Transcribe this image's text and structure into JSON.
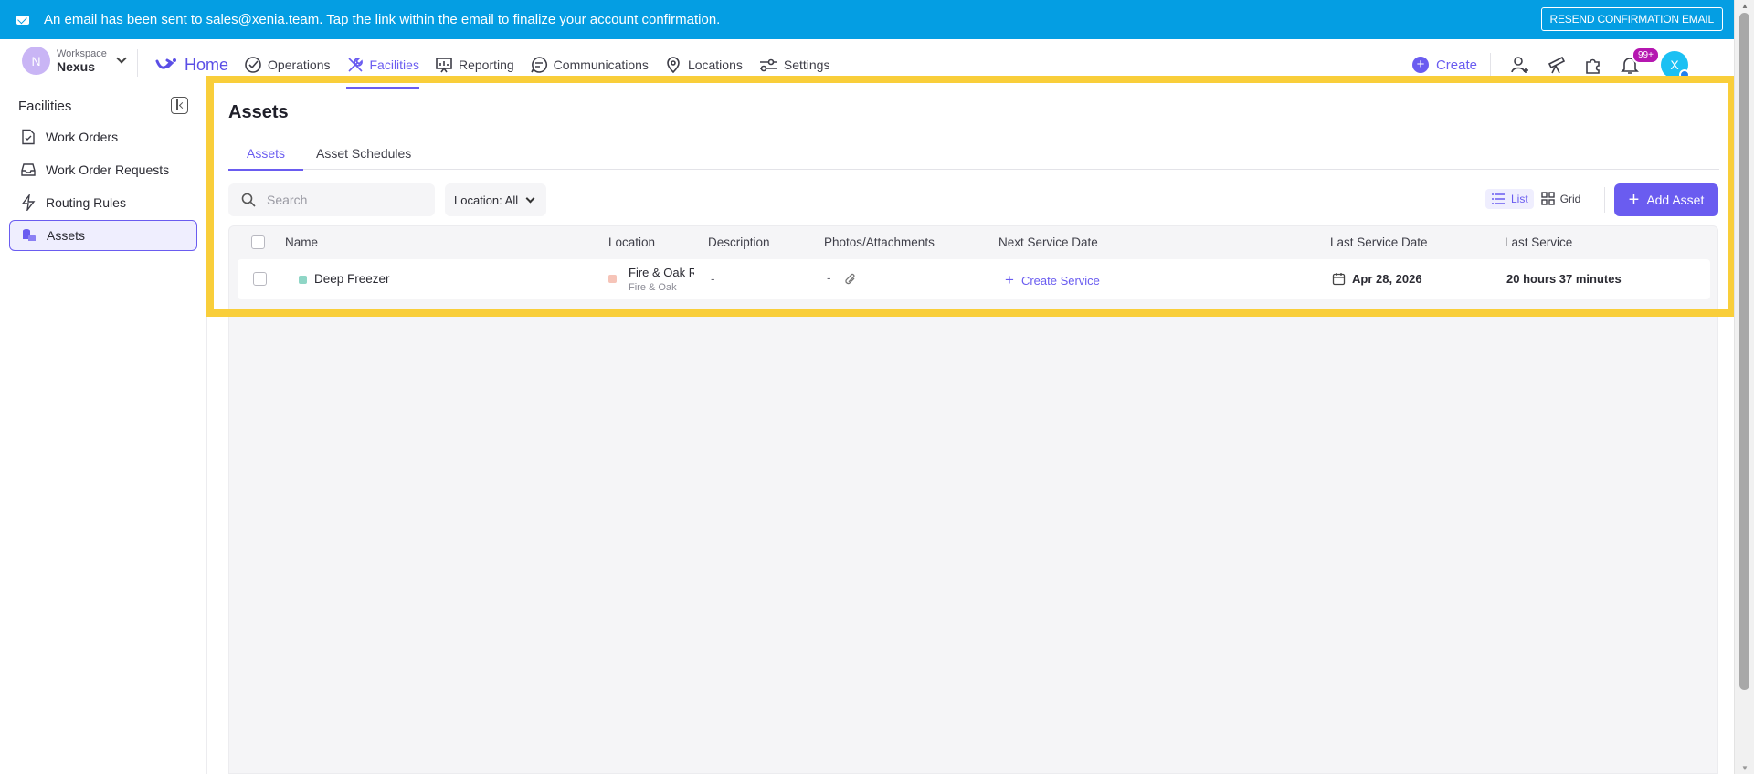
{
  "banner": {
    "message": "An email has been sent to sales@xenia.team. Tap the link within the email to finalize your account confirmation.",
    "action_label": "RESEND CONFIRMATION EMAIL"
  },
  "workspace": {
    "initial": "N",
    "label": "Workspace",
    "name": "Nexus"
  },
  "nav": {
    "home": "Home",
    "items": [
      "Operations",
      "Facilities",
      "Reporting",
      "Communications",
      "Locations",
      "Settings"
    ],
    "active": "Facilities",
    "create_label": "Create",
    "notification_badge": "99+",
    "user_initial": "X"
  },
  "sidebar": {
    "title": "Facilities",
    "items": [
      {
        "label": "Work Orders",
        "icon": "file-check-icon"
      },
      {
        "label": "Work Order Requests",
        "icon": "inbox-icon"
      },
      {
        "label": "Routing Rules",
        "icon": "bolt-icon"
      },
      {
        "label": "Assets",
        "icon": "assets-icon",
        "active": true
      }
    ]
  },
  "page": {
    "title": "Assets",
    "tabs": [
      "Assets",
      "Asset Schedules"
    ],
    "active_tab": "Assets",
    "search_placeholder": "Search",
    "location_filter": "Location: All",
    "view_list": "List",
    "view_grid": "Grid",
    "add_label": "Add Asset"
  },
  "table": {
    "columns": [
      "Name",
      "Location",
      "Description",
      "Photos/Attachments",
      "Next Service Date",
      "Last Service Date",
      "Last Service"
    ],
    "rows": [
      {
        "name": "Deep Freezer",
        "name_color": "#8fd6c6",
        "location": "Fire & Oak Re",
        "location_sub": "Fire & Oak",
        "location_color": "#f6c4b8",
        "description": "-",
        "photos": "-",
        "next_service": "Create Service",
        "last_service_date": "Apr 28, 2026",
        "last_service": "20 hours 37 minutes"
      }
    ]
  },
  "colors": {
    "accent": "#6a5cf0",
    "banner": "#049ee3",
    "highlight": "#f9ce3a"
  }
}
